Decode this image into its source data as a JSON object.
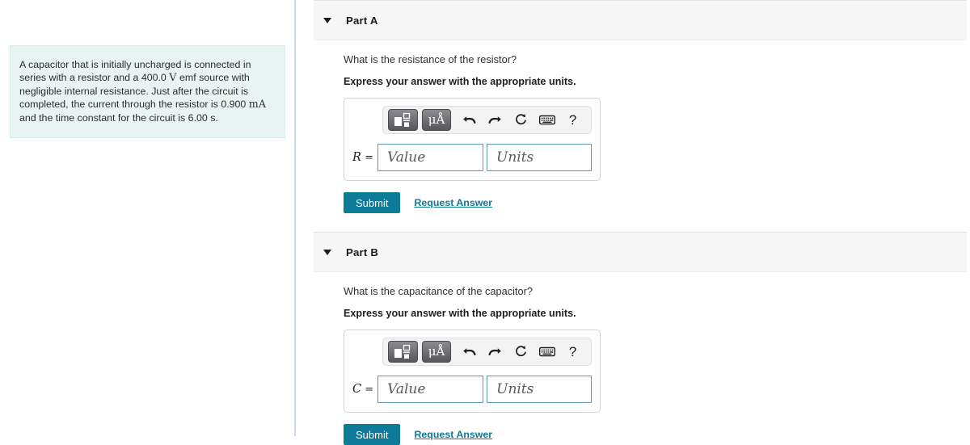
{
  "problem": {
    "text_segments": [
      {
        "t": "A capacitor that is initially uncharged is connected in series with a resistor and a 400.0 ",
        "m": false
      },
      {
        "t": "V",
        "m": true
      },
      {
        "t": " emf source with negligible internal resistance. Just after the circuit is completed, the current through the resistor is 0.900 ",
        "m": false
      },
      {
        "t": "mA",
        "m": true
      },
      {
        "t": " and the time constant for the circuit is 6.00 s.",
        "m": false
      }
    ],
    "full_text": "A capacitor that is initially uncharged is connected in series with a resistor and a 400.0 V emf source with negligible internal resistance. Just after the circuit is completed, the current through the resistor is 0.900 mA and the time constant for the circuit is 6.00 s."
  },
  "toolbar": {
    "template_button_label": "math-template",
    "units_button_label": "μÅ",
    "undo_label": "undo",
    "redo_label": "redo",
    "reset_label": "reset",
    "keyboard_label": "keyboard",
    "help_label": "?"
  },
  "parts": [
    {
      "id": "part-a",
      "title": "Part A",
      "question": "What is the resistance of the resistor?",
      "instruction": "Express your answer with the appropriate units.",
      "variable": "R",
      "equals": "=",
      "value_placeholder": "Value",
      "units_placeholder": "Units",
      "value": "",
      "units": "",
      "submit_label": "Submit",
      "request_answer_label": "Request Answer"
    },
    {
      "id": "part-b",
      "title": "Part B",
      "question": "What is the capacitance of the capacitor?",
      "instruction": "Express your answer with the appropriate units.",
      "variable": "C",
      "equals": "=",
      "value_placeholder": "Value",
      "units_placeholder": "Units",
      "value": "",
      "units": "",
      "submit_label": "Submit",
      "request_answer_label": "Request Answer"
    }
  ],
  "colors": {
    "problem_panel_bg": "#e7f4f2",
    "divider": "#ccd8e4",
    "part_header_bg": "#f7f7f7",
    "accent_teal": "#0e7a99",
    "input_border": "#5b9cb5"
  }
}
